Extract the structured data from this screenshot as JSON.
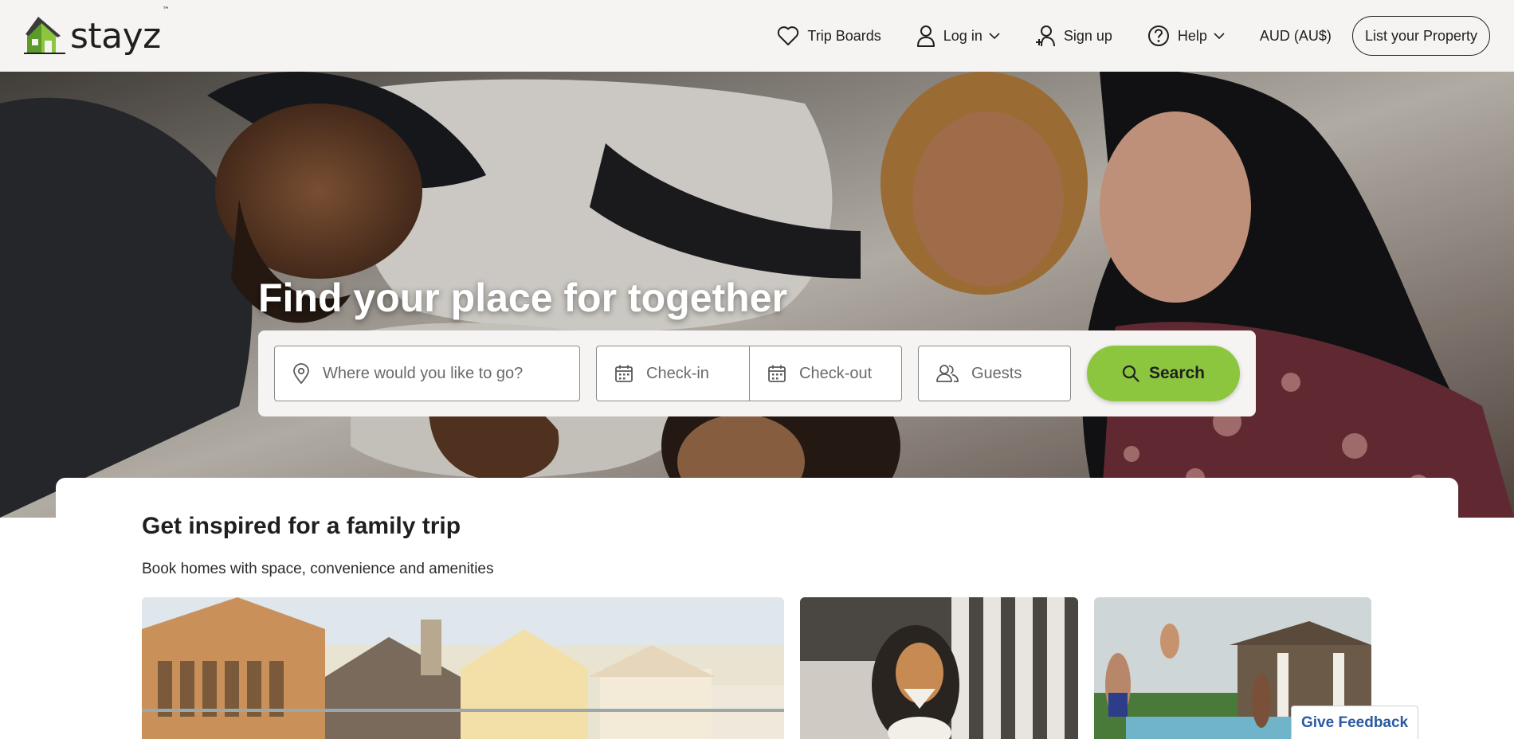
{
  "brand": {
    "name": "stayz",
    "tm": "™"
  },
  "nav": {
    "trip_boards": "Trip Boards",
    "log_in": "Log in",
    "sign_up": "Sign up",
    "help": "Help",
    "currency": "AUD (AU$)",
    "list_property": "List your Property"
  },
  "hero": {
    "title": "Find your place for together"
  },
  "search": {
    "where_placeholder": "Where would you like to go?",
    "checkin_placeholder": "Check-in",
    "checkout_placeholder": "Check-out",
    "guests_placeholder": "Guests",
    "button_label": "Search"
  },
  "inspire": {
    "title": "Get inspired for a family trip",
    "subtitle": "Book homes with space, convenience and amenities"
  },
  "feedback": {
    "label": "Give Feedback"
  },
  "colors": {
    "accent_green": "#8cc63f",
    "header_bg": "#f5f4f2",
    "feedback_blue": "#2c5aa0"
  },
  "icons": {
    "trip_boards": "heart-icon",
    "log_in": "user-icon",
    "sign_up": "user-plus-icon",
    "help": "question-circle-icon",
    "where": "map-pin-icon",
    "checkin": "calendar-icon",
    "checkout": "calendar-icon",
    "guests": "users-icon",
    "search": "search-icon"
  }
}
